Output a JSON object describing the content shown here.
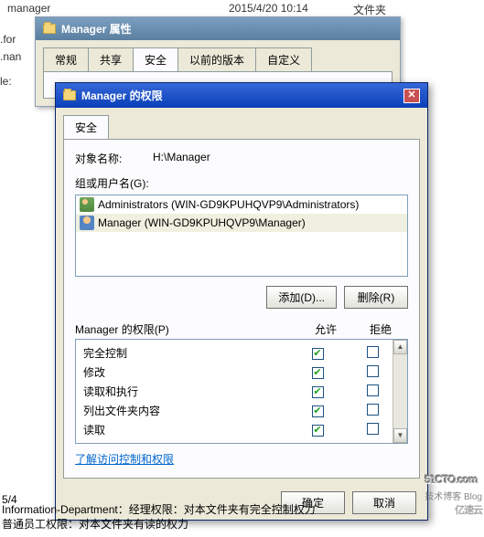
{
  "bg": {
    "folder": "manager",
    "date": "2015/4/20 10:14",
    "type": "文件夹",
    "left1": ".for",
    "left2": ".nan",
    "left3": "le:"
  },
  "win1": {
    "title": "Manager 属性",
    "tabs": [
      "常规",
      "共享",
      "安全",
      "以前的版本",
      "自定义"
    ]
  },
  "win2": {
    "title": "Manager 的权限",
    "tab": "安全",
    "object_label": "对象名称:",
    "object_value": "H:\\Manager",
    "group_label": "组或用户名(G):",
    "users": [
      {
        "name": "Administrators (WIN-GD9KPUHQVP9\\Administrators)"
      },
      {
        "name": "Manager (WIN-GD9KPUHQVP9\\Manager)"
      }
    ],
    "add": "添加(D)...",
    "remove": "删除(R)",
    "perm_label": "Manager 的权限(P)",
    "allow": "允许",
    "deny": "拒绝",
    "perms": [
      {
        "name": "完全控制",
        "allow": true,
        "deny": false
      },
      {
        "name": "修改",
        "allow": true,
        "deny": false
      },
      {
        "name": "读取和执行",
        "allow": true,
        "deny": false
      },
      {
        "name": "列出文件夹内容",
        "allow": true,
        "deny": false
      },
      {
        "name": "读取",
        "allow": true,
        "deny": false
      }
    ],
    "link": "了解访问控制和权限",
    "ok": "确定",
    "cancel": "取消"
  },
  "status": "5/4",
  "footer": {
    "l1": "Information-Department：经理权限：对本文件夹有完全控制权力",
    "l2": "普通员工权限：对本文件夹有读的权力"
  },
  "watermark": {
    "main": "51CTO.com",
    "sub": "技术博客   Blog",
    "cloud": "亿速云"
  }
}
